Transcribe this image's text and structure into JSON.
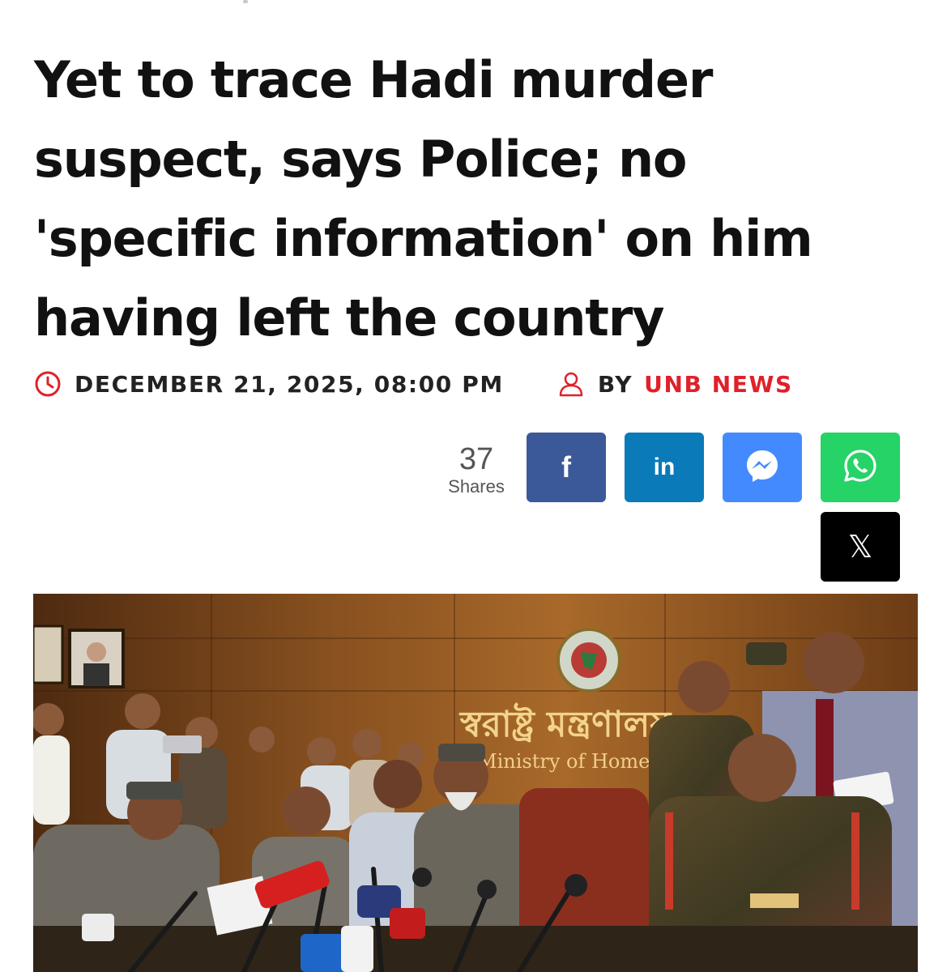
{
  "article": {
    "headline": "Yet to trace Hadi murder suspect, says Police; no 'specific information' on him having left the country",
    "date": "DECEMBER 21, 2025, 08:00 PM",
    "by_label": "BY",
    "author": "UNB NEWS"
  },
  "share_bar": {
    "count": "37",
    "count_label": "Shares",
    "buttons": [
      {
        "name": "facebook",
        "label": "f",
        "color": "#3b5998",
        "icon": "facebook-icon"
      },
      {
        "name": "linkedin",
        "label": "in",
        "color": "#0a7ab8",
        "icon": "linkedin-icon"
      },
      {
        "name": "messenger",
        "label": "",
        "color": "#448aff",
        "icon": "messenger-icon"
      },
      {
        "name": "whatsapp",
        "label": "",
        "color": "#25d366",
        "icon": "whatsapp-icon"
      },
      {
        "name": "x",
        "label": "𝕏",
        "color": "#000000",
        "icon": "x-icon"
      }
    ]
  },
  "photo": {
    "wall_text_bengali": "স্বরাষ্ট্র মন্ত্রণালয়",
    "wall_text_english": "Ministry of Home"
  },
  "colors": {
    "accent": "#e0202a",
    "text": "#111111"
  }
}
